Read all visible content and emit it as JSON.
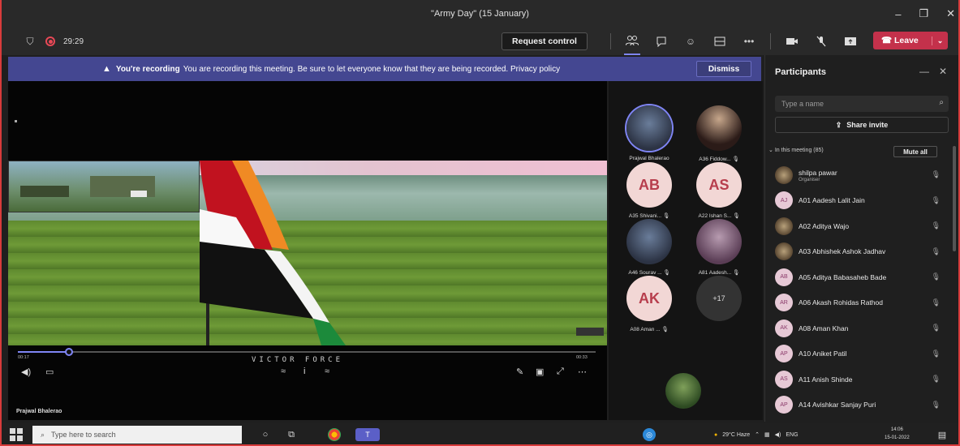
{
  "window": {
    "title": "\"Army Day\" (15 January)",
    "minimize": "–",
    "maximize": "❐",
    "close": "✕"
  },
  "toolbar": {
    "timer": "29:29",
    "request_control": "Request control",
    "leave": "Leave"
  },
  "banner": {
    "strong": "You're recording",
    "message": "You are recording this meeting. Be sure to let everyone know that they are being recorded. Privacy policy",
    "dismiss": "Dismiss"
  },
  "stage": {
    "video_caption": "VICTOR FORCE",
    "time_elapsed": "00:17",
    "time_total": "00:33",
    "presenter": "Prajwal Bhalerao"
  },
  "gallery": [
    {
      "initials": "",
      "name": "Prajwal Bhalerao"
    },
    {
      "initials": "",
      "name": "A36 Fiddow..."
    },
    {
      "initials": "AB",
      "name": "A35 Shivani..."
    },
    {
      "initials": "AS",
      "name": "A22 Ishan S..."
    },
    {
      "initials": "",
      "name": "A46 Sourav ..."
    },
    {
      "initials": "",
      "name": "A81 Aadesh..."
    },
    {
      "initials": "AK",
      "name": "A08 Aman ..."
    },
    {
      "initials": "+17",
      "name": ""
    }
  ],
  "participants": {
    "title": "Participants",
    "search_placeholder": "Type a name",
    "share_invite": "Share invite",
    "in_meeting": "In this meeting (85)",
    "mute_all": "Mute all",
    "list": [
      {
        "initials": "",
        "name": "shilpa pawar",
        "sub": "Organiser"
      },
      {
        "initials": "AJ",
        "name": "A01 Aadesh Lalit Jain",
        "sub": ""
      },
      {
        "initials": "",
        "name": "A02 Aditya Wajo",
        "sub": ""
      },
      {
        "initials": "",
        "name": "A03 Abhishek Ashok Jadhav",
        "sub": ""
      },
      {
        "initials": "AB",
        "name": "A05 Aditya Babasaheb Bade",
        "sub": ""
      },
      {
        "initials": "AR",
        "name": "A06 Akash Rohidas Rathod",
        "sub": ""
      },
      {
        "initials": "AK",
        "name": "A08 Aman Khan",
        "sub": ""
      },
      {
        "initials": "AP",
        "name": "A10 Aniket Patil",
        "sub": ""
      },
      {
        "initials": "AS",
        "name": "A11 Anish Shinde",
        "sub": ""
      },
      {
        "initials": "AP",
        "name": "A14 Avishkar Sanjay Puri",
        "sub": ""
      }
    ]
  },
  "taskbar": {
    "search_placeholder": "Type here to search",
    "weather": "29°C Haze",
    "language": "ENG",
    "time": "14:06",
    "date": "15-01-2022"
  }
}
